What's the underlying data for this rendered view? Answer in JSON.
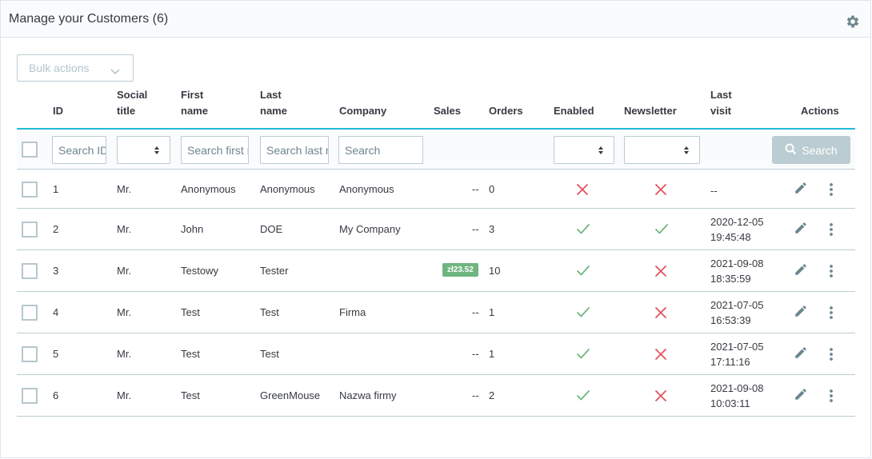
{
  "header": {
    "title": "Manage your Customers (6)",
    "settings_icon": "gear-icon"
  },
  "toolbar": {
    "bulk_label": "Bulk actions"
  },
  "columns": {
    "id": "ID",
    "social_title_1": "Social",
    "social_title_2": "title",
    "first_name_1": "First",
    "first_name_2": "name",
    "last_name_1": "Last",
    "last_name_2": "name",
    "company": "Company",
    "sales": "Sales",
    "orders": "Orders",
    "enabled": "Enabled",
    "newsletter": "Newsletter",
    "last_visit_1": "Last",
    "last_visit_2": "visit",
    "actions": "Actions"
  },
  "filters": {
    "id_placeholder": "Search ID",
    "first_name_placeholder": "Search first name",
    "last_name_placeholder": "Search last name",
    "company_placeholder": "Search",
    "search_button": "Search"
  },
  "rows": [
    {
      "id": "1",
      "title": "Mr.",
      "first": "Anonymous",
      "last": "Anonymous",
      "company": "Anonymous",
      "sales": "--",
      "sales_badge": false,
      "orders": "0",
      "enabled": false,
      "newsletter": false,
      "visit": "--"
    },
    {
      "id": "2",
      "title": "Mr.",
      "first": "John",
      "last": "DOE",
      "company": "My Company",
      "sales": "--",
      "sales_badge": false,
      "orders": "3",
      "enabled": true,
      "newsletter": true,
      "visit": "2020-12-05 19:45:48"
    },
    {
      "id": "3",
      "title": "Mr.",
      "first": "Testowy",
      "last": "Tester",
      "company": "",
      "sales": "zł23.52",
      "sales_badge": true,
      "orders": "10",
      "enabled": true,
      "newsletter": false,
      "visit": "2021-09-08 18:35:59"
    },
    {
      "id": "4",
      "title": "Mr.",
      "first": "Test",
      "last": "Test",
      "company": "Firma",
      "sales": "--",
      "sales_badge": false,
      "orders": "1",
      "enabled": true,
      "newsletter": false,
      "visit": "2021-07-05 16:53:39"
    },
    {
      "id": "5",
      "title": "Mr.",
      "first": "Test",
      "last": "Test",
      "company": "",
      "sales": "--",
      "sales_badge": false,
      "orders": "1",
      "enabled": true,
      "newsletter": false,
      "visit": "2021-07-05 17:11:16"
    },
    {
      "id": "6",
      "title": "Mr.",
      "first": "Test",
      "last": "GreenMouse",
      "company": "Nazwa firmy",
      "sales": "--",
      "sales_badge": false,
      "orders": "2",
      "enabled": true,
      "newsletter": false,
      "visit": "2021-09-08 10:03:11"
    }
  ],
  "icons": {
    "edit": "pencil-icon",
    "more": "kebab-menu-icon",
    "yes": "check-icon",
    "no": "cross-icon"
  },
  "colors": {
    "accent": "#25b9d7",
    "success": "#70b580",
    "danger": "#e2525e",
    "muted": "#bbcdd2"
  }
}
